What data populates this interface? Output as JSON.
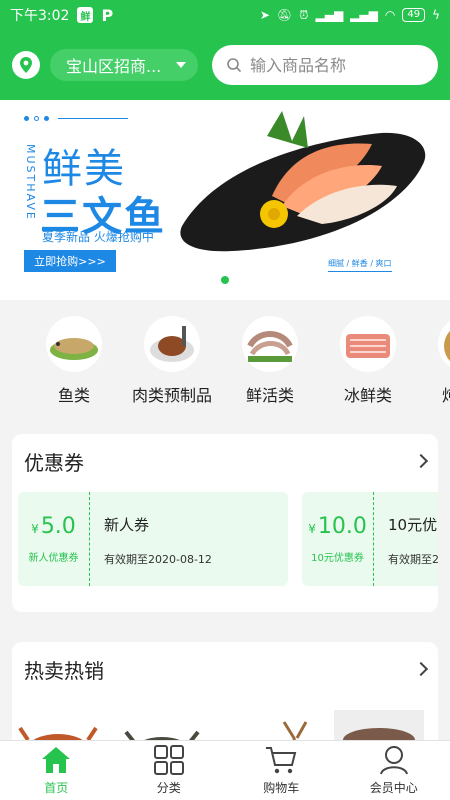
{
  "status_bar": {
    "time": "下午3:02",
    "app_badge": "鲜",
    "app_p": "P",
    "battery": "49"
  },
  "header": {
    "location": "宝山区招商...",
    "search_placeholder": "输入商品名称"
  },
  "banner": {
    "vertical_text": "MUSTHAVE",
    "title_line1": "鲜美",
    "title_line2": "三文鱼",
    "subtitle": "夏季新品 火爆抢购中",
    "cta": "立即抢购>>>",
    "tags": "细腻 / 鲜香 / 爽口",
    "colors": {
      "accent": "#1e88e5"
    }
  },
  "categories": [
    {
      "label": "鱼类",
      "icon": "fish-photo"
    },
    {
      "label": "肉类预制品",
      "icon": "meat-photo"
    },
    {
      "label": "鲜活类",
      "icon": "shrimp-photo"
    },
    {
      "label": "冰鲜类",
      "icon": "frozen-fish-photo"
    },
    {
      "label": "炖品捞",
      "icon": "stew-photo"
    }
  ],
  "coupons_section": {
    "title": "优惠券",
    "items": [
      {
        "currency": "¥",
        "amount": "5.0",
        "tag": "新人优惠券",
        "name": "新人券",
        "expiry": "有效期至2020-08-12"
      },
      {
        "currency": "¥",
        "amount": "10.0",
        "tag": "10元优惠券",
        "name": "10元优",
        "expiry": "有效期至2"
      }
    ]
  },
  "hot_section": {
    "title": "热卖热销"
  },
  "tabbar": {
    "items": [
      {
        "label": "首页",
        "icon": "home-icon",
        "active": true
      },
      {
        "label": "分类",
        "icon": "category-icon",
        "active": false
      },
      {
        "label": "购物车",
        "icon": "cart-icon",
        "active": false
      },
      {
        "label": "会员中心",
        "icon": "user-icon",
        "active": false
      }
    ]
  },
  "colors": {
    "brand": "#27c34f",
    "background": "#f3f3f3"
  }
}
